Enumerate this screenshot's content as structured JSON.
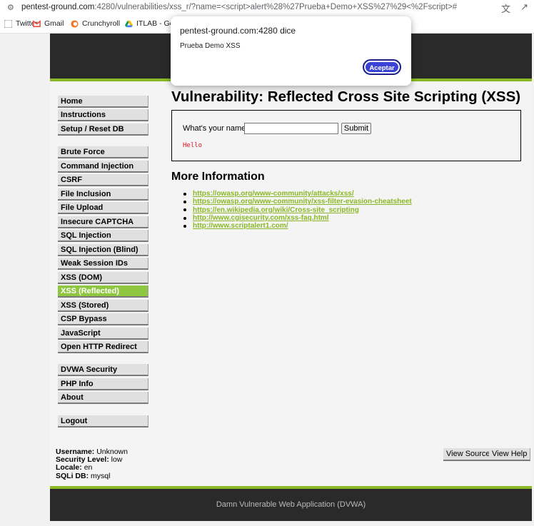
{
  "browser": {
    "url_host": "pentest-ground.com",
    "url_rest": ":4280/vulnerabilities/xss_r/?name=<script>alert%28%27Prueba+Demo+XSS%27%29<%2Fscript>#",
    "bookmarks": [
      {
        "label": "Twitter",
        "icon": "twitter-icon"
      },
      {
        "label": "Gmail",
        "icon": "gmail-icon"
      },
      {
        "label": "Crunchyroll",
        "icon": "crunchyroll-icon"
      },
      {
        "label": "ITLAB - Goo",
        "icon": "google-drive-icon"
      }
    ]
  },
  "dialog": {
    "title": "pentest-ground.com:4280 dice",
    "message": "Prueba Demo XSS",
    "button": "Aceptar"
  },
  "menu": [
    [
      "Home",
      "Instructions",
      "Setup / Reset DB"
    ],
    [
      "Brute Force",
      "Command Injection",
      "CSRF",
      "File Inclusion",
      "File Upload",
      "Insecure CAPTCHA",
      "SQL Injection",
      "SQL Injection (Blind)",
      "Weak Session IDs",
      "XSS (DOM)",
      "XSS (Reflected)",
      "XSS (Stored)",
      "CSP Bypass",
      "JavaScript",
      "Open HTTP Redirect"
    ],
    [
      "DVWA Security",
      "PHP Info",
      "About"
    ],
    [
      "Logout"
    ]
  ],
  "selected_menu": "XSS (Reflected)",
  "main": {
    "title": "Vulnerability: Reflected Cross Site Scripting (XSS)",
    "form_label": "What's your name?",
    "input_value": "",
    "submit_label": "Submit",
    "output": "Hello",
    "more_info_title": "More Information",
    "links": [
      "https://owasp.org/www-community/attacks/xss/",
      "https://owasp.org/www-community/xss-filter-evasion-cheatsheet",
      "https://en.wikipedia.org/wiki/Cross-site_scripting",
      "http://www.cgisecurity.com/xss-faq.html",
      "http://www.scriptalert1.com/"
    ]
  },
  "status": {
    "username_label": "Username:",
    "username": "Unknown",
    "security_label": "Security Level:",
    "security": "low",
    "locale_label": "Locale:",
    "locale": "en",
    "sqli_label": "SQLi DB:",
    "sqli": "mysql"
  },
  "buttons": {
    "view_source": "View Source",
    "view_help": "View Help"
  },
  "footer": "Damn Vulnerable Web Application (DVWA)",
  "colors": {
    "accent": "#8ab826",
    "selected_menu": "#8fc63f",
    "header": "#2a2a2a",
    "dialog_button": "#3b43d6",
    "output_text": "#e0161b"
  }
}
